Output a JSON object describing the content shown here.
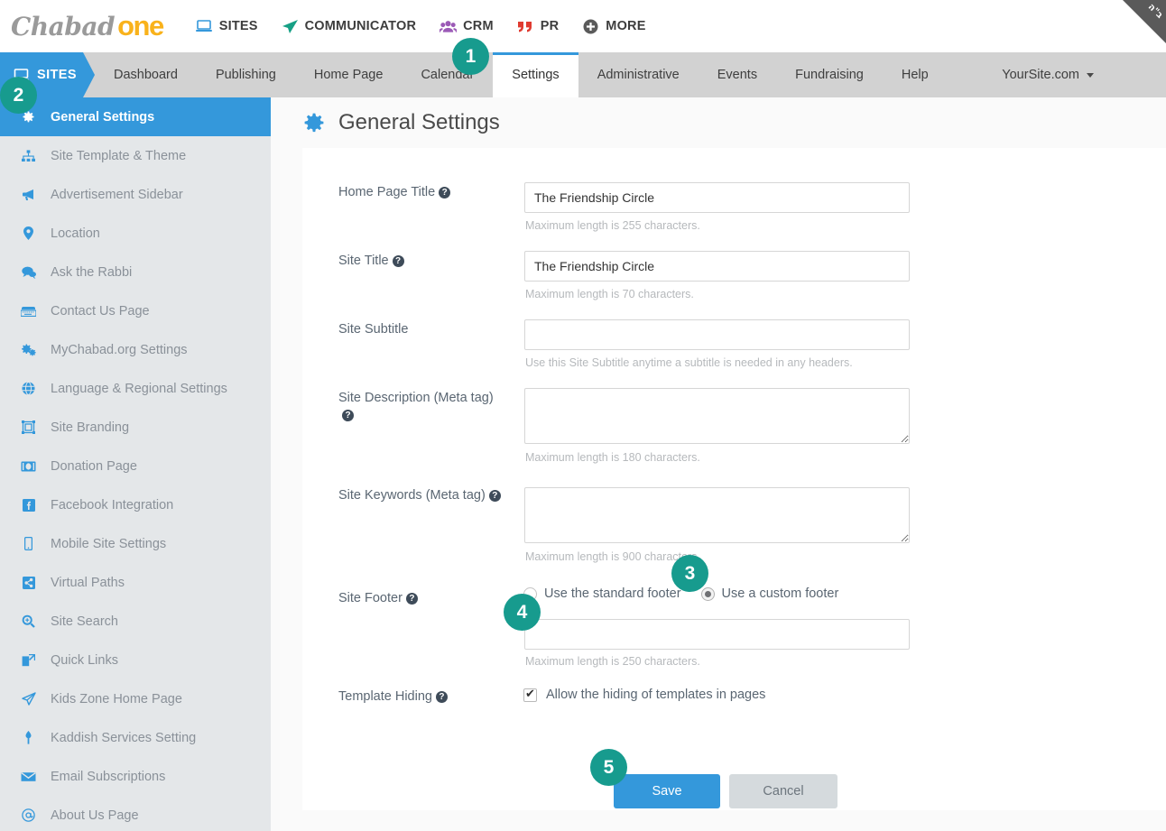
{
  "brand": {
    "logo_primary": "Chabad",
    "logo_secondary": "one",
    "corner_ribbon": "ב\"ה"
  },
  "topnav": {
    "items": [
      {
        "label": "SITES",
        "icon": "laptop-icon",
        "color": "#3498db"
      },
      {
        "label": "COMMUNICATOR",
        "icon": "paper-plane-icon",
        "color": "#16a085"
      },
      {
        "label": "CRM",
        "icon": "users-icon",
        "color": "#9b59b6"
      },
      {
        "label": "PR",
        "icon": "quote-icon",
        "color": "#e03b30"
      },
      {
        "label": "MORE",
        "icon": "plus-circle-icon",
        "color": "#5a5a5a"
      }
    ]
  },
  "subnav": {
    "section_label": "SITES",
    "section_icon": "monitor-icon",
    "items": [
      {
        "label": "Dashboard",
        "active": false
      },
      {
        "label": "Publishing",
        "active": false
      },
      {
        "label": "Home Page",
        "active": false
      },
      {
        "label": "Calendar",
        "active": false
      },
      {
        "label": "Settings",
        "active": true
      },
      {
        "label": "Administrative",
        "active": false
      },
      {
        "label": "Events",
        "active": false
      },
      {
        "label": "Fundraising",
        "active": false
      },
      {
        "label": "Help",
        "active": false
      }
    ],
    "site_selector": "YourSite.com"
  },
  "sidebar": {
    "items": [
      {
        "label": "General Settings",
        "icon": "gear-icon",
        "active": true
      },
      {
        "label": "Site Template & Theme",
        "icon": "sitemap-icon",
        "active": false
      },
      {
        "label": "Advertisement Sidebar",
        "icon": "megaphone-icon",
        "active": false
      },
      {
        "label": "Location",
        "icon": "map-pin-icon",
        "active": false
      },
      {
        "label": "Ask the Rabbi",
        "icon": "comments-icon",
        "active": false
      },
      {
        "label": "Contact Us Page",
        "icon": "keyboard-icon",
        "active": false
      },
      {
        "label": "MyChabad.org Settings",
        "icon": "cogs-icon",
        "active": false
      },
      {
        "label": "Language & Regional Settings",
        "icon": "globe-icon",
        "active": false
      },
      {
        "label": "Site Branding",
        "icon": "frame-icon",
        "active": false
      },
      {
        "label": "Donation Page",
        "icon": "money-icon",
        "active": false
      },
      {
        "label": "Facebook Integration",
        "icon": "facebook-icon",
        "active": false
      },
      {
        "label": "Mobile Site Settings",
        "icon": "mobile-icon",
        "active": false
      },
      {
        "label": "Virtual Paths",
        "icon": "share-icon",
        "active": false
      },
      {
        "label": "Site Search",
        "icon": "search-plus-icon",
        "active": false
      },
      {
        "label": "Quick Links",
        "icon": "external-link-icon",
        "active": false
      },
      {
        "label": "Kids Zone Home Page",
        "icon": "paper-plane-icon",
        "active": false
      },
      {
        "label": "Kaddish Services Setting",
        "icon": "candle-icon",
        "active": false
      },
      {
        "label": "Email Subscriptions",
        "icon": "envelope-icon",
        "active": false
      },
      {
        "label": "About Us Page",
        "icon": "at-icon",
        "active": false
      }
    ]
  },
  "page": {
    "title": "General Settings",
    "title_icon": "gear-icon"
  },
  "form": {
    "home_page_title": {
      "label": "Home Page Title",
      "has_help": true,
      "value": "The Friendship Circle",
      "hint": "Maximum length is 255 characters."
    },
    "site_title": {
      "label": "Site Title",
      "has_help": true,
      "value": "The Friendship Circle",
      "hint": "Maximum length is 70 characters."
    },
    "site_subtitle": {
      "label": "Site Subtitle",
      "has_help": false,
      "value": "",
      "hint": "Use this Site Subtitle anytime a subtitle is needed in any headers."
    },
    "site_description": {
      "label": "Site Description (Meta tag)",
      "has_help": true,
      "value": "",
      "hint": "Maximum length is 180 characters."
    },
    "site_keywords": {
      "label": "Site Keywords (Meta tag)",
      "has_help": true,
      "value": "",
      "hint": "Maximum length is 900 characters."
    },
    "site_footer": {
      "label": "Site Footer",
      "has_help": true,
      "options": [
        {
          "label": "Use the standard footer",
          "selected": false
        },
        {
          "label": "Use a custom footer",
          "selected": true
        }
      ],
      "value": "",
      "hint": "Maximum length is 250 characters."
    },
    "template_hiding": {
      "label": "Template Hiding",
      "has_help": true,
      "checkbox_label": "Allow the hiding of templates in pages",
      "checked": true
    },
    "actions": {
      "save": "Save",
      "cancel": "Cancel"
    }
  },
  "annotations": [
    {
      "number": "1",
      "target": "settings-tab"
    },
    {
      "number": "2",
      "target": "general-settings-sidebar-item"
    },
    {
      "number": "3",
      "target": "custom-footer-radio"
    },
    {
      "number": "4",
      "target": "custom-footer-input"
    },
    {
      "number": "5",
      "target": "save-button"
    }
  ],
  "colors": {
    "accent_blue": "#3498db",
    "annotation_teal": "#179b8e",
    "brand_yellow": "#f9b21b",
    "sidebar_bg": "#e4e7e9",
    "subnav_bg": "#d2d2d2"
  }
}
